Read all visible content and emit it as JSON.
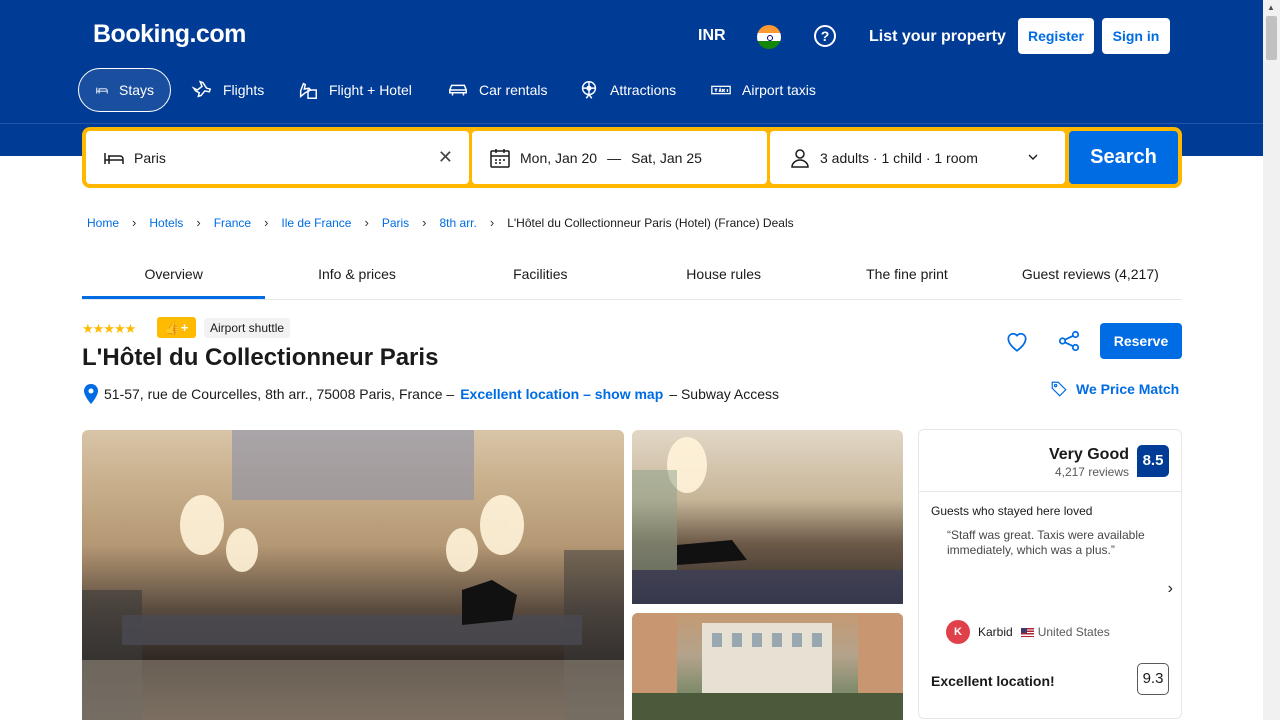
{
  "header": {
    "logo": "Booking.com",
    "currency": "INR",
    "help_icon": "question-circle-icon",
    "list_property": "List your property",
    "register": "Register",
    "sign_in": "Sign in"
  },
  "nav": [
    {
      "label": "Stays",
      "icon": "bed-icon",
      "active": true
    },
    {
      "label": "Flights",
      "icon": "plane-icon"
    },
    {
      "label": "Flight + Hotel",
      "icon": "plane-hotel-icon"
    },
    {
      "label": "Car rentals",
      "icon": "car-icon"
    },
    {
      "label": "Attractions",
      "icon": "ferris-wheel-icon"
    },
    {
      "label": "Airport taxis",
      "icon": "taxi-icon"
    }
  ],
  "search": {
    "destination": "Paris",
    "dates_start": "Mon, Jan 20",
    "dates_sep": "—",
    "dates_end": "Sat, Jan 25",
    "guests": "3 adults · 1 child · 1 room",
    "button": "Search"
  },
  "breadcrumb": [
    "Home",
    "Hotels",
    "France",
    "Ile de France",
    "Paris",
    "8th arr."
  ],
  "breadcrumb_current": "L'Hôtel du Collectionneur Paris (Hotel) (France) Deals",
  "tabs": [
    "Overview",
    "Info & prices",
    "Facilities",
    "House rules",
    "The fine print",
    "Guest reviews (4,217)"
  ],
  "hotel": {
    "stars": "★★★★★",
    "airport_shuttle": "Airport shuttle",
    "name": "L'Hôtel du Collectionneur Paris",
    "address": "51-57, rue de Courcelles, 8th arr., 75008 Paris, France –",
    "location_link": "Excellent location – show map",
    "address_suffix": "– Subway Access",
    "reserve": "Reserve",
    "price_match": "We Price Match"
  },
  "review": {
    "word": "Very Good",
    "count": "4,217 reviews",
    "score": "8.5",
    "loved_label": "Guests who stayed here loved",
    "quote": "“Staff was great. Taxis were available immediately, which was a plus.”",
    "author_initial": "K",
    "author": "Karbid",
    "country": "United States",
    "location_label": "Excellent location!",
    "location_score": "9.3"
  },
  "colors": {
    "brand_blue": "#003b95",
    "action_blue": "#006ce4",
    "search_yellow": "#ffb700"
  }
}
